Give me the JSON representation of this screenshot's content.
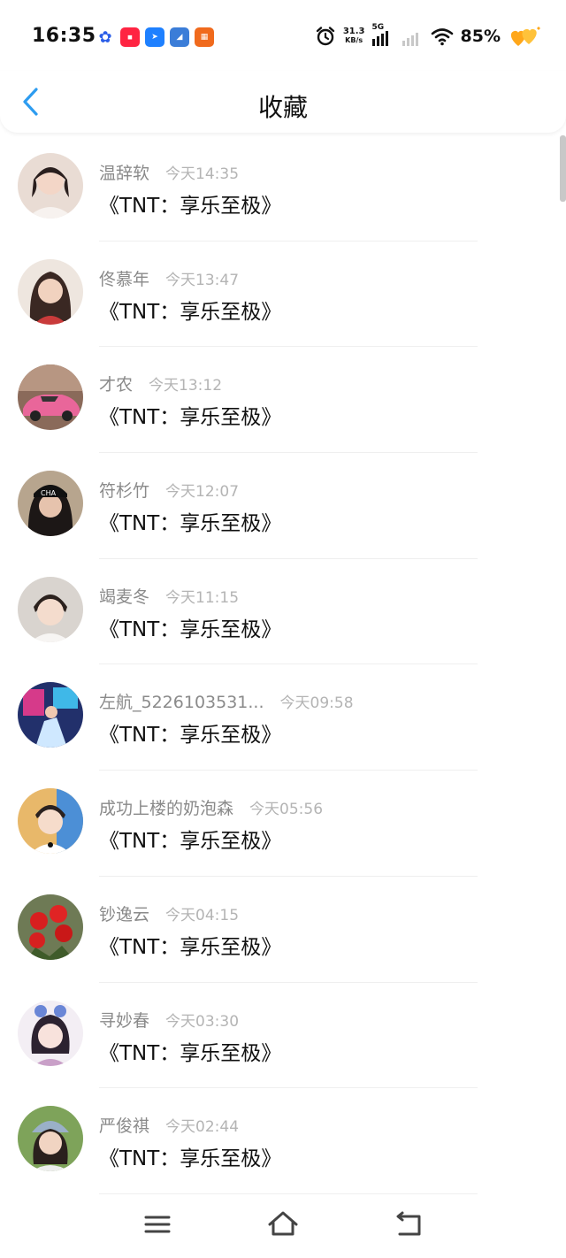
{
  "status_bar": {
    "time": "16:35",
    "net_speed_value": "31.3",
    "net_speed_unit": "KB/s",
    "network_type": "5G",
    "battery": "85%",
    "app_icons": [
      "baidu-icon",
      "xiaohongshu-icon",
      "chat-bubble-icon",
      "blue-app-icon",
      "orange-app-icon"
    ]
  },
  "header": {
    "title": "收藏",
    "back_icon": "chevron-left-icon",
    "accent_color": "#2d9cf0"
  },
  "items": [
    {
      "name": "温辞软",
      "time": "今天14:35",
      "content": "《TNT：享乐至极》"
    },
    {
      "name": "佟慕年",
      "time": "今天13:47",
      "content": "《TNT：享乐至极》"
    },
    {
      "name": "才农",
      "time": "今天13:12",
      "content": "《TNT：享乐至极》"
    },
    {
      "name": "符杉竹",
      "time": "今天12:07",
      "content": "《TNT：享乐至极》"
    },
    {
      "name": "竭麦冬",
      "time": "今天11:15",
      "content": "《TNT：享乐至极》"
    },
    {
      "name": "左航_5226103531...",
      "time": "今天09:58",
      "content": "《TNT：享乐至极》"
    },
    {
      "name": "成功上楼的奶泡森",
      "time": "今天05:56",
      "content": "《TNT：享乐至极》"
    },
    {
      "name": "钞逸云",
      "time": "今天04:15",
      "content": "《TNT：享乐至极》"
    },
    {
      "name": "寻妙春",
      "time": "今天03:30",
      "content": "《TNT：享乐至极》"
    },
    {
      "name": "严俊祺",
      "time": "今天02:44",
      "content": "《TNT：享乐至极》"
    }
  ],
  "nav": {
    "menu_icon": "menu-icon",
    "home_icon": "home-icon",
    "back_icon": "back-icon"
  }
}
